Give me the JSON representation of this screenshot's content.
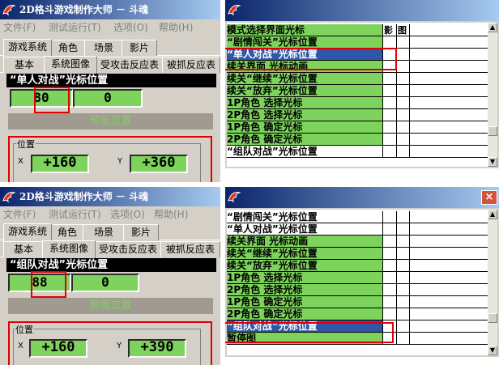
{
  "panel1": {
    "main": {
      "title": "2D格斗游戏制作大师 － 斗魂",
      "menu": [
        "文件(F)",
        "测试运行(T)",
        "选项(O)",
        "帮助(H)"
      ],
      "tabs1": [
        "游戏系统",
        "角色",
        "场景",
        "影片"
      ],
      "tabs2": [
        "基本",
        "系统图像",
        "受攻击反应表",
        "被抓反应表"
      ],
      "header": "“单人对战”光标位置",
      "field_a": "80",
      "field_b": "0",
      "gray_button": "预览位置",
      "group_label": "位置",
      "x_label": "X",
      "x_value": "+160",
      "y_label": "Y",
      "y_value": "+360"
    },
    "list": {
      "columns": [
        "模式选择界面光标",
        "影",
        "图"
      ],
      "rows": [
        {
          "label": "“剧情闯关”光标位置",
          "state": "normal"
        },
        {
          "label": "“单人对战”光标位置",
          "state": "selected"
        },
        {
          "label": "续关界面 光标动画",
          "state": "normal"
        },
        {
          "label": "续关“继续”光标位置",
          "state": "normal"
        },
        {
          "label": "续关“放弃”光标位置",
          "state": "normal"
        },
        {
          "label": "1P角色 选择光标",
          "state": "normal"
        },
        {
          "label": "2P角色 选择光标",
          "state": "normal"
        },
        {
          "label": "1P角色 确定光标",
          "state": "normal"
        },
        {
          "label": "2P角色 确定光标",
          "state": "normal"
        },
        {
          "label": "“组队对战”光标位置",
          "state": "white"
        }
      ]
    }
  },
  "panel2": {
    "main": {
      "title": "2D格斗游戏制作大师 － 斗魂",
      "menu": [
        "文件(F)",
        "测试运行(T)",
        "选项(O)",
        "帮助(H)"
      ],
      "tabs1": [
        "游戏系统",
        "角色",
        "场景",
        "影片"
      ],
      "tabs2": [
        "基本",
        "系统图像",
        "受攻击反应表",
        "被抓反应表"
      ],
      "header": "“组队对战”光标位置",
      "field_a": "88",
      "field_b": "0",
      "gray_button": "预览位置",
      "group_label": "位置",
      "x_label": "X",
      "x_value": "+160",
      "y_label": "Y",
      "y_value": "+390"
    },
    "list": {
      "rows": [
        {
          "label": "“剧情闯关”光标位置",
          "state": "white"
        },
        {
          "label": "“单人对战”光标位置",
          "state": "white"
        },
        {
          "label": "续关界面 光标动画",
          "state": "normal"
        },
        {
          "label": "续关“继续”光标位置",
          "state": "normal"
        },
        {
          "label": "续关“放弃”光标位置",
          "state": "normal"
        },
        {
          "label": "1P角色 选择光标",
          "state": "normal"
        },
        {
          "label": "2P角色 选择光标",
          "state": "normal"
        },
        {
          "label": "1P角色 确定光标",
          "state": "normal"
        },
        {
          "label": "2P角色 确定光标",
          "state": "normal"
        },
        {
          "label": "“组队对战”光标位置",
          "state": "selected"
        },
        {
          "label": "暂停图",
          "state": "normal"
        }
      ]
    }
  },
  "icons": {
    "app": "dragon-icon",
    "close": "close-icon",
    "scroll_up": "arrow-up-icon",
    "scroll_down": "arrow-down-icon"
  },
  "colors": {
    "title_from": "#0a246a",
    "title_to": "#a6caf0",
    "green": "#7dd35c",
    "selection": "#2f56a8",
    "highlight": "#e00000"
  },
  "close_symbol": "×",
  "scroll_up_symbol": "▲",
  "scroll_down_symbol": "▼"
}
